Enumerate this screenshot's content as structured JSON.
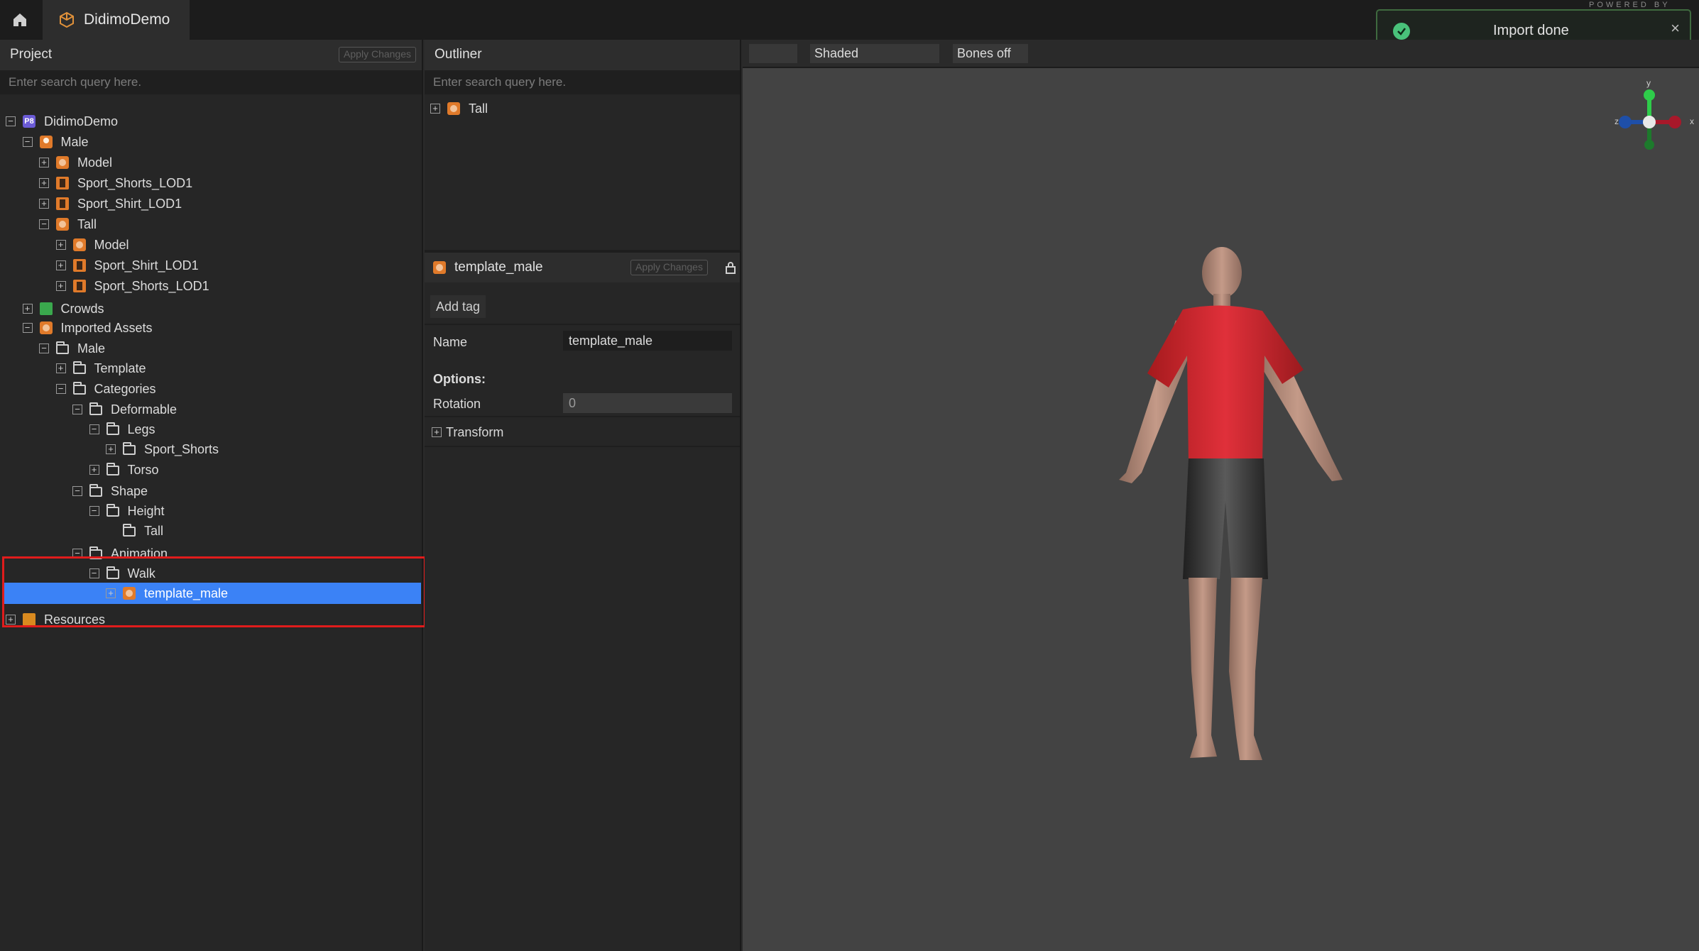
{
  "app": {
    "tab_label": "DidimoDemo"
  },
  "toast": {
    "message": "Import done"
  },
  "watermark": "POWERED BY",
  "project_panel": {
    "title": "Project",
    "apply_label": "Apply Changes",
    "search_placeholder": "Enter search query here.",
    "tree": [
      {
        "label": "DidimoDemo",
        "depth": 0,
        "state": "expanded",
        "icon": "project-icon",
        "icon_text": "P8"
      },
      {
        "label": "Male",
        "depth": 1,
        "state": "expanded",
        "icon": "person-icon"
      },
      {
        "label": "Model",
        "depth": 2,
        "state": "collapsed",
        "icon": "asset-icon"
      },
      {
        "label": "Sport_Shorts_LOD1",
        "depth": 2,
        "state": "collapsed",
        "icon": "garment-icon"
      },
      {
        "label": "Sport_Shirt_LOD1",
        "depth": 2,
        "state": "collapsed",
        "icon": "garment-icon"
      },
      {
        "label": "Tall",
        "depth": 2,
        "state": "expanded",
        "icon": "asset-icon"
      },
      {
        "label": "Model",
        "depth": 3,
        "state": "collapsed",
        "icon": "asset-icon"
      },
      {
        "label": "Sport_Shirt_LOD1",
        "depth": 3,
        "state": "collapsed",
        "icon": "garment-icon"
      },
      {
        "label": "Sport_Shorts_LOD1",
        "depth": 3,
        "state": "collapsed",
        "icon": "garment-icon"
      },
      {
        "label": "Crowds",
        "depth": 1,
        "state": "collapsed",
        "icon": "crowd-icon"
      },
      {
        "label": "Imported Assets",
        "depth": 1,
        "state": "expanded",
        "icon": "asset-icon"
      },
      {
        "label": "Male",
        "depth": 2,
        "state": "expanded",
        "icon": "folder-icon"
      },
      {
        "label": "Template",
        "depth": 3,
        "state": "collapsed",
        "icon": "folder-icon"
      },
      {
        "label": "Categories",
        "depth": 3,
        "state": "expanded",
        "icon": "folder-icon"
      },
      {
        "label": "Deformable",
        "depth": 4,
        "state": "expanded",
        "icon": "folder-icon"
      },
      {
        "label": "Legs",
        "depth": 5,
        "state": "expanded",
        "icon": "folder-icon"
      },
      {
        "label": "Sport_Shorts",
        "depth": 6,
        "state": "collapsed",
        "icon": "folder-icon"
      },
      {
        "label": "Torso",
        "depth": 5,
        "state": "collapsed",
        "icon": "folder-icon"
      },
      {
        "label": "Shape",
        "depth": 4,
        "state": "expanded",
        "icon": "folder-icon"
      },
      {
        "label": "Height",
        "depth": 5,
        "state": "expanded",
        "icon": "folder-icon"
      },
      {
        "label": "Tall",
        "depth": 6,
        "state": "none",
        "icon": "folder-icon"
      },
      {
        "label": "Animation",
        "depth": 4,
        "state": "expanded",
        "icon": "folder-icon"
      },
      {
        "label": "Walk",
        "depth": 5,
        "state": "expanded",
        "icon": "folder-icon"
      },
      {
        "label": "template_male",
        "depth": 6,
        "state": "collapsed",
        "icon": "asset-icon",
        "selected": true
      },
      {
        "label": "Resources",
        "depth": 0,
        "state": "collapsed",
        "icon": "resources-icon"
      }
    ]
  },
  "outliner": {
    "title": "Outliner",
    "search_placeholder": "Enter search query here.",
    "items": [
      {
        "label": "Tall"
      }
    ]
  },
  "properties": {
    "asset_name": "template_male",
    "apply_label": "Apply Changes",
    "add_tag_label": "Add tag",
    "name_label": "Name",
    "name_value": "template_male",
    "options_label": "Options:",
    "rotation_label": "Rotation",
    "rotation_value": "0",
    "transform_label": "Transform"
  },
  "viewport": {
    "shading": "Shaded",
    "bones": "Bones off",
    "gizmo": {
      "x": "x",
      "y": "y",
      "z": "z"
    }
  },
  "colors": {
    "selection": "#3b82f6",
    "highlight": "#e01c1c",
    "accent": "#e07a2a"
  }
}
